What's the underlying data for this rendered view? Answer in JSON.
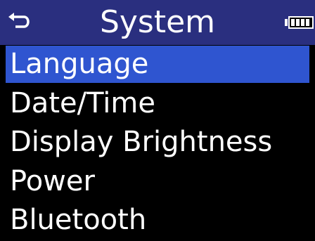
{
  "colors": {
    "header_bg": "#2a2f7f",
    "selected_bg": "#2f55d0",
    "text": "#ffffff",
    "screen_bg": "#000000"
  },
  "header": {
    "title": "System",
    "left_icon": "back-arrow-icon",
    "right_icon": "battery-icon",
    "battery_level": 1.0
  },
  "menu": {
    "items": [
      {
        "label": "Language",
        "selected": true
      },
      {
        "label": "Date/Time",
        "selected": false
      },
      {
        "label": "Display Brightness",
        "selected": false
      },
      {
        "label": "Power",
        "selected": false
      },
      {
        "label": "Bluetooth",
        "selected": false
      }
    ]
  }
}
